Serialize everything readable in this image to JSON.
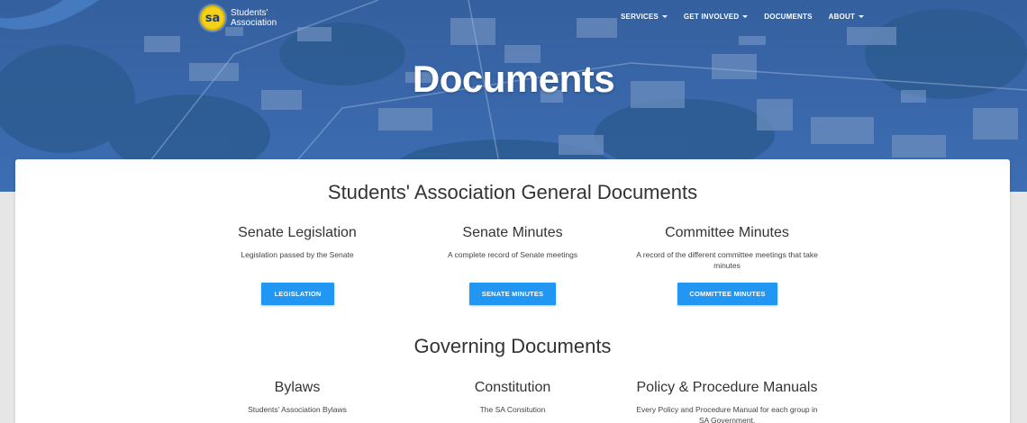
{
  "site": {
    "logo_mark": "sa",
    "logo_line1": "Students'",
    "logo_line2": "Association"
  },
  "nav": {
    "services": "SERVICES",
    "get_involved": "GET INVOLVED",
    "documents": "DOCUMENTS",
    "about": "ABOUT"
  },
  "hero": {
    "title": "Documents"
  },
  "general": {
    "title": "Students' Association General Documents",
    "columns": [
      {
        "title": "Senate Legislation",
        "description": "Legislation passed by the Senate",
        "button": "LEGISLATION"
      },
      {
        "title": "Senate Minutes",
        "description": "A complete record of Senate meetings",
        "button": "SENATE MINUTES"
      },
      {
        "title": "Committee Minutes",
        "description": "A record of the different committee meetings that take minutes",
        "button": "COMMITTEE MINUTES"
      }
    ]
  },
  "governing": {
    "title": "Governing Documents",
    "columns": [
      {
        "title": "Bylaws",
        "description": "Students' Association Bylaws"
      },
      {
        "title": "Constitution",
        "description": "The SA Consitution"
      },
      {
        "title": "Policy & Procedure Manuals",
        "description": "Every Policy and Procedure Manual for each group in SA Government."
      }
    ]
  },
  "colors": {
    "primary_button": "#2196f3",
    "hero_tint": "#2f5fa8",
    "logo_yellow": "#f4d11b"
  }
}
